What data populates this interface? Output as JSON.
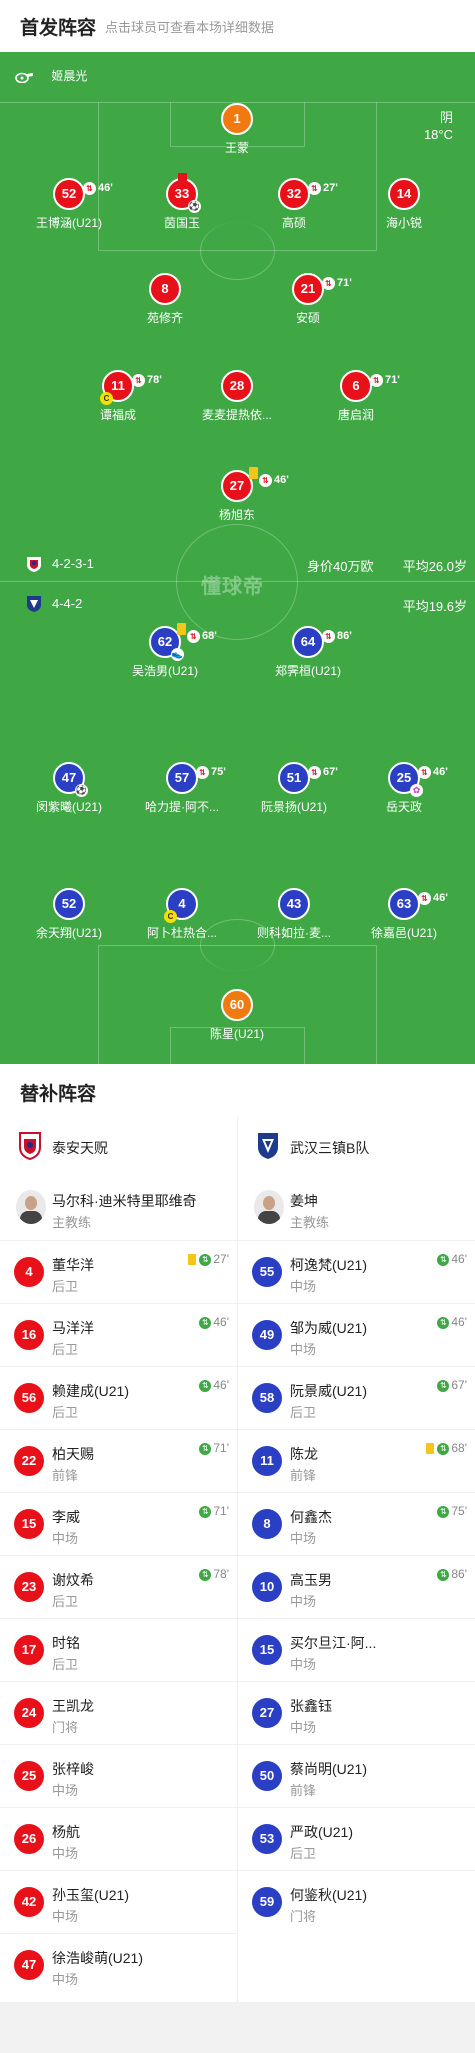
{
  "header": {
    "title": "首发阵容",
    "subtitle": "点击球员可查看本场详细数据"
  },
  "match": {
    "referee": "姬晨光",
    "weather": "阴",
    "temperature": "18°C",
    "watermark": "懂球帝"
  },
  "home": {
    "formation": "4-2-3-1",
    "value": "身价40万欧",
    "avg_age": "平均26.0岁",
    "color": "#e8111a"
  },
  "away": {
    "formation": "4-4-2",
    "avg_age": "平均19.6岁",
    "color": "#2b3fc4"
  },
  "players": [
    {
      "num": "1",
      "name": "王蒙",
      "sub": ""
    },
    {
      "num": "52",
      "name": "王博涵(U21)",
      "sub": "46'"
    },
    {
      "num": "33",
      "name": "茵国玉",
      "sub": ""
    },
    {
      "num": "32",
      "name": "高硕",
      "sub": "27'"
    },
    {
      "num": "14",
      "name": "海小锐",
      "sub": ""
    },
    {
      "num": "8",
      "name": "苑修齐",
      "sub": ""
    },
    {
      "num": "21",
      "name": "安硕",
      "sub": "71'"
    },
    {
      "num": "11",
      "name": "谭福成",
      "sub": "78'"
    },
    {
      "num": "28",
      "name": "麦麦提热依...",
      "sub": ""
    },
    {
      "num": "6",
      "name": "唐启润",
      "sub": "71'"
    },
    {
      "num": "27",
      "name": "杨旭东",
      "sub": "46'"
    },
    {
      "num": "62",
      "name": "吴浩男(U21)",
      "sub": "68'"
    },
    {
      "num": "64",
      "name": "郑霁桓(U21)",
      "sub": "86'"
    },
    {
      "num": "47",
      "name": "闵紫曦(U21)",
      "sub": ""
    },
    {
      "num": "57",
      "name": "哈力提·阿不...",
      "sub": "75'"
    },
    {
      "num": "51",
      "name": "阮景扬(U21)",
      "sub": "67'"
    },
    {
      "num": "25",
      "name": "岳天政",
      "sub": "46'"
    },
    {
      "num": "52",
      "name": "余天翔(U21)",
      "sub": ""
    },
    {
      "num": "4",
      "name": "阿卜杜热合...",
      "sub": ""
    },
    {
      "num": "43",
      "name": "则科如拉·麦...",
      "sub": ""
    },
    {
      "num": "63",
      "name": "徐嘉邑(U21)",
      "sub": "46'"
    },
    {
      "num": "60",
      "name": "陈星(U21)",
      "sub": ""
    }
  ],
  "subs": {
    "title": "替补阵容",
    "home": {
      "team": "泰安天贶",
      "coach": {
        "name": "马尔科·迪米特里耶维奇",
        "role": "主教练"
      },
      "list": [
        {
          "num": "4",
          "name": "董华洋",
          "pos": "后卫",
          "min": "27'",
          "card": "yellow"
        },
        {
          "num": "16",
          "name": "马洋洋",
          "pos": "后卫",
          "min": "46'",
          "card": ""
        },
        {
          "num": "56",
          "name": "赖建成(U21)",
          "pos": "后卫",
          "min": "46'",
          "card": ""
        },
        {
          "num": "22",
          "name": "柏天赐",
          "pos": "前锋",
          "min": "71'",
          "card": ""
        },
        {
          "num": "15",
          "name": "李威",
          "pos": "中场",
          "min": "71'",
          "card": ""
        },
        {
          "num": "23",
          "name": "谢炆希",
          "pos": "后卫",
          "min": "78'",
          "card": ""
        },
        {
          "num": "17",
          "name": "时铭",
          "pos": "后卫",
          "min": "",
          "card": ""
        },
        {
          "num": "24",
          "name": "王凯龙",
          "pos": "门将",
          "min": "",
          "card": ""
        },
        {
          "num": "25",
          "name": "张梓峻",
          "pos": "中场",
          "min": "",
          "card": ""
        },
        {
          "num": "26",
          "name": "杨航",
          "pos": "中场",
          "min": "",
          "card": ""
        },
        {
          "num": "42",
          "name": "孙玉玺(U21)",
          "pos": "中场",
          "min": "",
          "card": ""
        },
        {
          "num": "47",
          "name": "徐浩峻萌(U21)",
          "pos": "中场",
          "min": "",
          "card": ""
        }
      ]
    },
    "away": {
      "team": "武汉三镇B队",
      "coach": {
        "name": "姜坤",
        "role": "主教练"
      },
      "list": [
        {
          "num": "55",
          "name": "柯逸梵(U21)",
          "pos": "中场",
          "min": "46'",
          "card": ""
        },
        {
          "num": "49",
          "name": "邹为威(U21)",
          "pos": "中场",
          "min": "46'",
          "card": ""
        },
        {
          "num": "58",
          "name": "阮景威(U21)",
          "pos": "后卫",
          "min": "67'",
          "card": ""
        },
        {
          "num": "11",
          "name": "陈龙",
          "pos": "前锋",
          "min": "68'",
          "card": "yellow"
        },
        {
          "num": "8",
          "name": "何鑫杰",
          "pos": "中场",
          "min": "75'",
          "card": ""
        },
        {
          "num": "10",
          "name": "高玉男",
          "pos": "中场",
          "min": "86'",
          "card": ""
        },
        {
          "num": "15",
          "name": "买尔旦江·阿...",
          "pos": "中场",
          "min": "",
          "card": ""
        },
        {
          "num": "27",
          "name": "张鑫钰",
          "pos": "中场",
          "min": "",
          "card": ""
        },
        {
          "num": "50",
          "name": "蔡尚明(U21)",
          "pos": "前锋",
          "min": "",
          "card": ""
        },
        {
          "num": "53",
          "name": "严政(U21)",
          "pos": "后卫",
          "min": "",
          "card": ""
        },
        {
          "num": "59",
          "name": "何鉴秋(U21)",
          "pos": "门将",
          "min": "",
          "card": ""
        }
      ]
    }
  }
}
